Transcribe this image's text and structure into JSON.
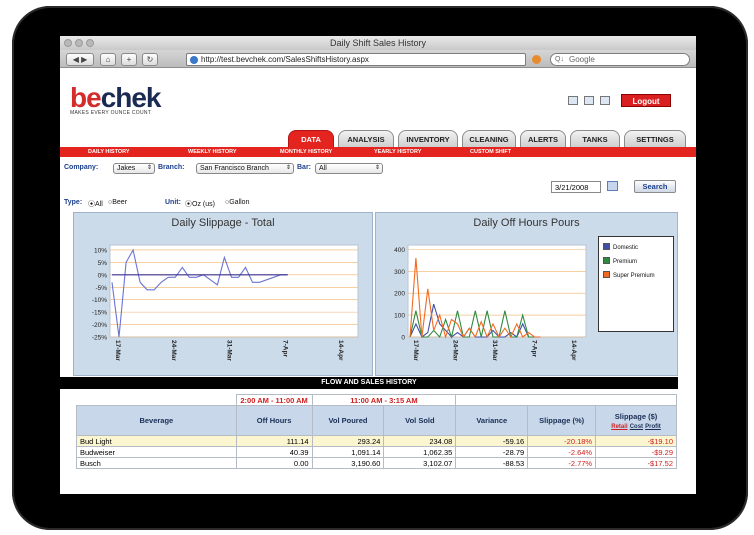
{
  "window": {
    "title": "Daily Shift Sales History"
  },
  "browser": {
    "url": "http://test.bevchek.com/SalesShiftsHistory.aspx",
    "search_placeholder": "Google",
    "search_prefix": "Q↓"
  },
  "app": {
    "logo_prefix": "be",
    "logo_suffix": "chek",
    "tagline": "MAKES EVERY OUNCE COUNT",
    "logout": "Logout"
  },
  "tabs": [
    "DATA",
    "ANALYSIS",
    "INVENTORY",
    "CLEANING",
    "ALERTS",
    "TANKS",
    "SETTINGS"
  ],
  "subnav": [
    "DAILY HISTORY",
    "WEEKLY HISTORY",
    "MONTHLY HISTORY",
    "YEARLY HISTORY",
    "CUSTOM SHIFT"
  ],
  "filters": {
    "company_label": "Company:",
    "company_value": "Jakes",
    "branch_label": "Branch:",
    "branch_value": "San Francisco Branch",
    "bar_label": "Bar:",
    "bar_value": "All",
    "date": "3/21/2008",
    "search": "Search",
    "type_label": "Type:",
    "type_all": "All",
    "type_beer": "Beer",
    "unit_label": "Unit:",
    "unit_oz": "Oz (us)",
    "unit_gallon": "Gallon"
  },
  "chart_data": [
    {
      "type": "line",
      "title": "Daily Slippage - Total",
      "y_ticks": [
        "10%",
        "5%",
        "0%",
        "-5%",
        "-10%",
        "-15%",
        "-20%",
        "-25%"
      ],
      "x_ticks": [
        "17-Mar",
        "24-Mar",
        "31-Mar",
        "7-Apr",
        "14-Apr"
      ],
      "ylim": [
        -25,
        12
      ],
      "series": [
        {
          "color": "#6b74d4",
          "values": [
            -3,
            -25,
            5,
            10,
            -3,
            -6,
            -6,
            -3,
            -1,
            -1,
            3,
            -1,
            -1,
            0,
            -2,
            -4,
            7,
            -1,
            -1,
            3,
            -3,
            -3,
            -2,
            -1,
            0,
            0
          ]
        },
        {
          "color": "#3b2e8c",
          "values": [
            0,
            0,
            0,
            0,
            0,
            0,
            0,
            0,
            0,
            0,
            0,
            0,
            0,
            0,
            0,
            0,
            0,
            0,
            0,
            0,
            0,
            0,
            0,
            0,
            0,
            0,
            0,
            0,
            0,
            0,
            0,
            0,
            0,
            0,
            0,
            0,
            0
          ]
        }
      ]
    },
    {
      "type": "line",
      "title": "Daily Off Hours Pours",
      "y_ticks": [
        "400",
        "300",
        "200",
        "100",
        "0"
      ],
      "x_ticks": [
        "17-Mar",
        "24-Mar",
        "31-Mar",
        "7-Apr",
        "14-Apr"
      ],
      "ylim": [
        0,
        420
      ],
      "series": [
        {
          "name": "Domestic",
          "color": "#3f4fa8",
          "values": [
            0,
            60,
            0,
            20,
            150,
            60,
            30,
            0,
            20,
            0,
            40,
            0,
            0,
            0,
            30,
            0,
            0,
            20,
            0,
            60,
            0,
            0,
            0
          ]
        },
        {
          "name": "Premium",
          "color": "#2e8b3e",
          "values": [
            0,
            120,
            0,
            0,
            30,
            0,
            80,
            0,
            120,
            0,
            0,
            120,
            0,
            120,
            0,
            0,
            120,
            0,
            0,
            100,
            0,
            0,
            0
          ]
        },
        {
          "name": "Super Premium",
          "color": "#f26a21",
          "values": [
            0,
            360,
            0,
            220,
            30,
            100,
            0,
            80,
            60,
            0,
            40,
            0,
            70,
            0,
            60,
            0,
            40,
            0,
            60,
            0,
            20,
            0,
            0
          ]
        }
      ]
    }
  ],
  "table": {
    "section_title": "FLOW AND SALES HISTORY",
    "range_off": "2:00 AM - 11:00 AM",
    "range_on": "11:00 AM - 3:15 AM",
    "headers": [
      "Beverage",
      "Off Hours",
      "Vol Poured",
      "Vol Sold",
      "Variance",
      "Slippage (%)",
      "Slippage ($)"
    ],
    "slip_links": [
      "Retail",
      "Cost",
      "Profit"
    ],
    "rows": [
      {
        "beverage": "Bud Light",
        "off": "111.14",
        "poured": "293.24",
        "sold": "234.08",
        "variance": "-59.16",
        "slip_pct": "-20.18%",
        "slip_usd": "-$19.10"
      },
      {
        "beverage": "Budweiser",
        "off": "40.39",
        "poured": "1,091.14",
        "sold": "1,062.35",
        "variance": "-28.79",
        "slip_pct": "-2.64%",
        "slip_usd": "-$9.29"
      },
      {
        "beverage": "Busch",
        "off": "0.00",
        "poured": "3,190.60",
        "sold": "3,102.07",
        "variance": "-88.53",
        "slip_pct": "-2.77%",
        "slip_usd": "-$17.52"
      }
    ]
  }
}
